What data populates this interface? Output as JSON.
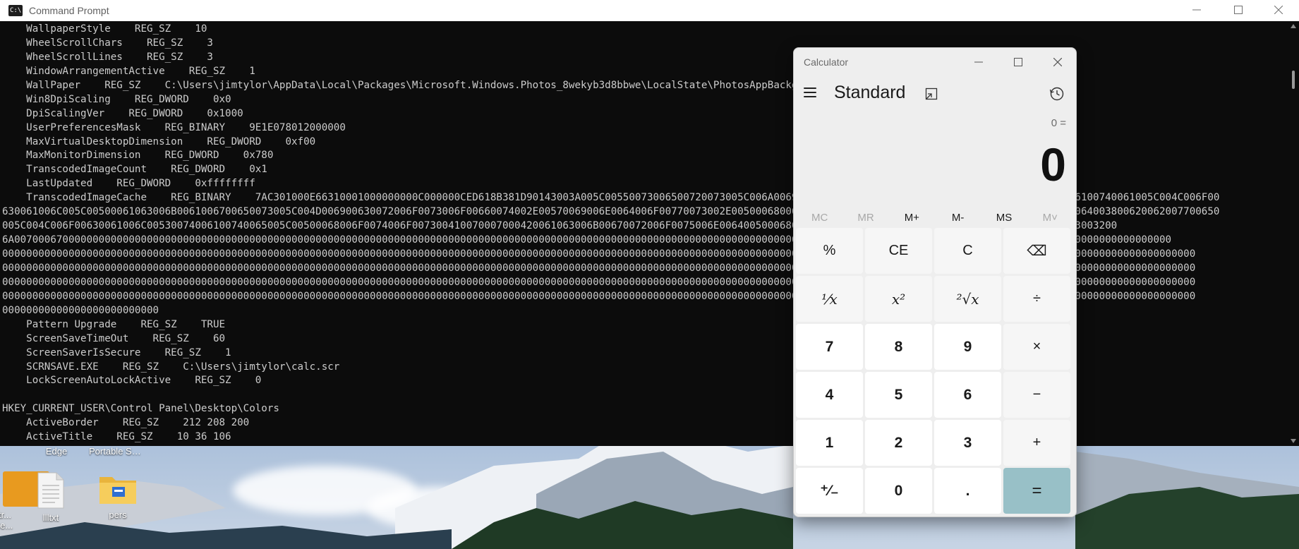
{
  "desktop": {
    "icons": [
      {
        "label": "Edge",
        "icon": "edge-shortcut-icon"
      },
      {
        "label": "Portable SS...",
        "icon": "folder-icon"
      },
      {
        "label": "tr...",
        "icon": "app-icon"
      },
      {
        "label": "re...",
        "icon": "app-icon"
      },
      {
        "label": "llltxt",
        "icon": "text-file-icon"
      },
      {
        "label": "pers",
        "icon": "folder-icon"
      }
    ]
  },
  "cmd": {
    "title": "Command Prompt",
    "lines": [
      "    WallpaperStyle    REG_SZ    10",
      "    WheelScrollChars    REG_SZ    3",
      "    WheelScrollLines    REG_SZ    3",
      "    WindowArrangementActive    REG_SZ    1",
      "    WallPaper    REG_SZ    C:\\Users\\jimtylor\\AppData\\Local\\Packages\\Microsoft.Windows.Photos_8wekyb3d8bbwe\\LocalState\\PhotosAppBackground\\",
      "    Win8DpiScaling    REG_DWORD    0x0",
      "    DpiScalingVer    REG_DWORD    0x1000",
      "    UserPreferencesMask    REG_BINARY    9E1E078012000000",
      "    MaxVirtualDesktopDimension    REG_DWORD    0xf00",
      "    MaxMonitorDimension    REG_DWORD    0x780",
      "    TranscodedImageCount    REG_DWORD    0x1",
      "    LastUpdated    REG_DWORD    0xffffffff",
      "    TranscodedImageCache    REG_BINARY    7AC301000E66310001000000000C000000CED618B381D90143003A005C00550073006500720073005C006A0069006D00740079006C006F0072005C0041007000700044006100740061005C004C006F00",
      "630061006C005C00500061063006B0061006700650073005C004D006900630072006F0073006F00660074002E00570069006E0064006F00770073002E00500068006F0074006F0073005F003800770065006B0079006200330064003800620062007700650",
      "005C004C006F00630061006C00530074006100740065005C00500068006F0074006F007300410070007000420061063006B00670072006F0075006E006400500068006F0074006F0073005C0031003600310033003000370033003200",
      "6A007000670000000000000000000000000000000000000000000000000000000000000000000000000000000000000000000000000000000000000000000000000000000000000000000000000000000000000000000000000000000000000000",
      "000000000000000000000000000000000000000000000000000000000000000000000000000000000000000000000000000000000000000000000000000000000000000000000000000000000000000000000000000000000000000000000000000000",
      "000000000000000000000000000000000000000000000000000000000000000000000000000000000000000000000000000000000000000000000000000000000000000000000000000000000000000000000000000000000000000000000000000000",
      "000000000000000000000000000000000000000000000000000000000000000000000000000000000000000000000000000000000000000000000000000000000000000000000000000000000000000000000000000000000000000000000000000000",
      "000000000000000000000000000000000000000000000000000000000000000000000000000000000000000000000000000000000000000000000000000000000000000000000000000000000000000000000000000000000000000000000000000000",
      "00000000000000000000000000",
      "    Pattern Upgrade    REG_SZ    TRUE",
      "    ScreenSaveTimeOut    REG_SZ    60",
      "    ScreenSaverIsSecure    REG_SZ    1",
      "    SCRNSAVE.EXE    REG_SZ    C:\\Users\\jimtylor\\calc.scr",
      "    LockScreenAutoLockActive    REG_SZ    0",
      "",
      "HKEY_CURRENT_USER\\Control Panel\\Desktop\\Colors",
      "    ActiveBorder    REG_SZ    212 208 200",
      "    ActiveTitle    REG_SZ    10 36 106"
    ]
  },
  "calc": {
    "title": "Calculator",
    "mode": "Standard",
    "expression": "0 =",
    "display": "0",
    "memory": [
      {
        "label": "MC",
        "enabled": false,
        "name": "memory-clear-button"
      },
      {
        "label": "MR",
        "enabled": false,
        "name": "memory-recall-button"
      },
      {
        "label": "M+",
        "enabled": true,
        "name": "memory-add-button"
      },
      {
        "label": "M-",
        "enabled": true,
        "name": "memory-subtract-button"
      },
      {
        "label": "MS",
        "enabled": true,
        "name": "memory-store-button"
      },
      {
        "label": "M˅",
        "enabled": false,
        "name": "memory-list-button"
      }
    ],
    "keys": [
      {
        "label": "%",
        "type": "op",
        "name": "percent-button"
      },
      {
        "label": "CE",
        "type": "op",
        "name": "clear-entry-button"
      },
      {
        "label": "C",
        "type": "op",
        "name": "clear-button"
      },
      {
        "label": "⌫",
        "type": "op",
        "name": "backspace-button"
      },
      {
        "label": "¹⁄x",
        "type": "fn",
        "name": "reciprocal-button"
      },
      {
        "label": "x²",
        "type": "fn",
        "name": "square-button"
      },
      {
        "label": "²√x",
        "type": "fn",
        "name": "square-root-button"
      },
      {
        "label": "÷",
        "type": "op",
        "name": "divide-button"
      },
      {
        "label": "7",
        "type": "num",
        "name": "digit-7-button"
      },
      {
        "label": "8",
        "type": "num",
        "name": "digit-8-button"
      },
      {
        "label": "9",
        "type": "num",
        "name": "digit-9-button"
      },
      {
        "label": "×",
        "type": "op",
        "name": "multiply-button"
      },
      {
        "label": "4",
        "type": "num",
        "name": "digit-4-button"
      },
      {
        "label": "5",
        "type": "num",
        "name": "digit-5-button"
      },
      {
        "label": "6",
        "type": "num",
        "name": "digit-6-button"
      },
      {
        "label": "−",
        "type": "op",
        "name": "minus-button"
      },
      {
        "label": "1",
        "type": "num",
        "name": "digit-1-button"
      },
      {
        "label": "2",
        "type": "num",
        "name": "digit-2-button"
      },
      {
        "label": "3",
        "type": "num",
        "name": "digit-3-button"
      },
      {
        "label": "+",
        "type": "op",
        "name": "plus-button"
      },
      {
        "label": "⁺⁄₋",
        "type": "num",
        "name": "negate-button"
      },
      {
        "label": "0",
        "type": "num",
        "name": "digit-0-button"
      },
      {
        "label": ".",
        "type": "num",
        "name": "decimal-button"
      },
      {
        "label": "=",
        "type": "eq",
        "name": "equals-button"
      }
    ],
    "accent": "#98c0c7"
  }
}
